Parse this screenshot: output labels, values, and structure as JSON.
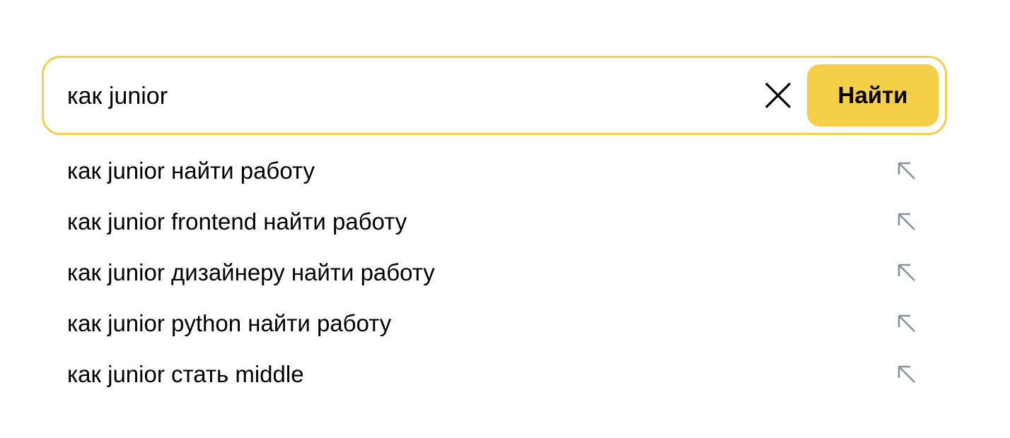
{
  "search": {
    "value": "как junior",
    "placeholder": "",
    "clear_icon": "close-icon",
    "submit_label": "Найти",
    "accent_color": "#f5cf47"
  },
  "suggestions": [
    {
      "text": "как junior найти работу",
      "icon": "arrow-up-left-icon"
    },
    {
      "text": "как junior frontend найти работу",
      "icon": "arrow-up-left-icon"
    },
    {
      "text": "как junior дизайнеру найти работу",
      "icon": "arrow-up-left-icon"
    },
    {
      "text": "как junior python найти работу",
      "icon": "arrow-up-left-icon"
    },
    {
      "text": "как junior стать middle",
      "icon": "arrow-up-left-icon"
    }
  ]
}
